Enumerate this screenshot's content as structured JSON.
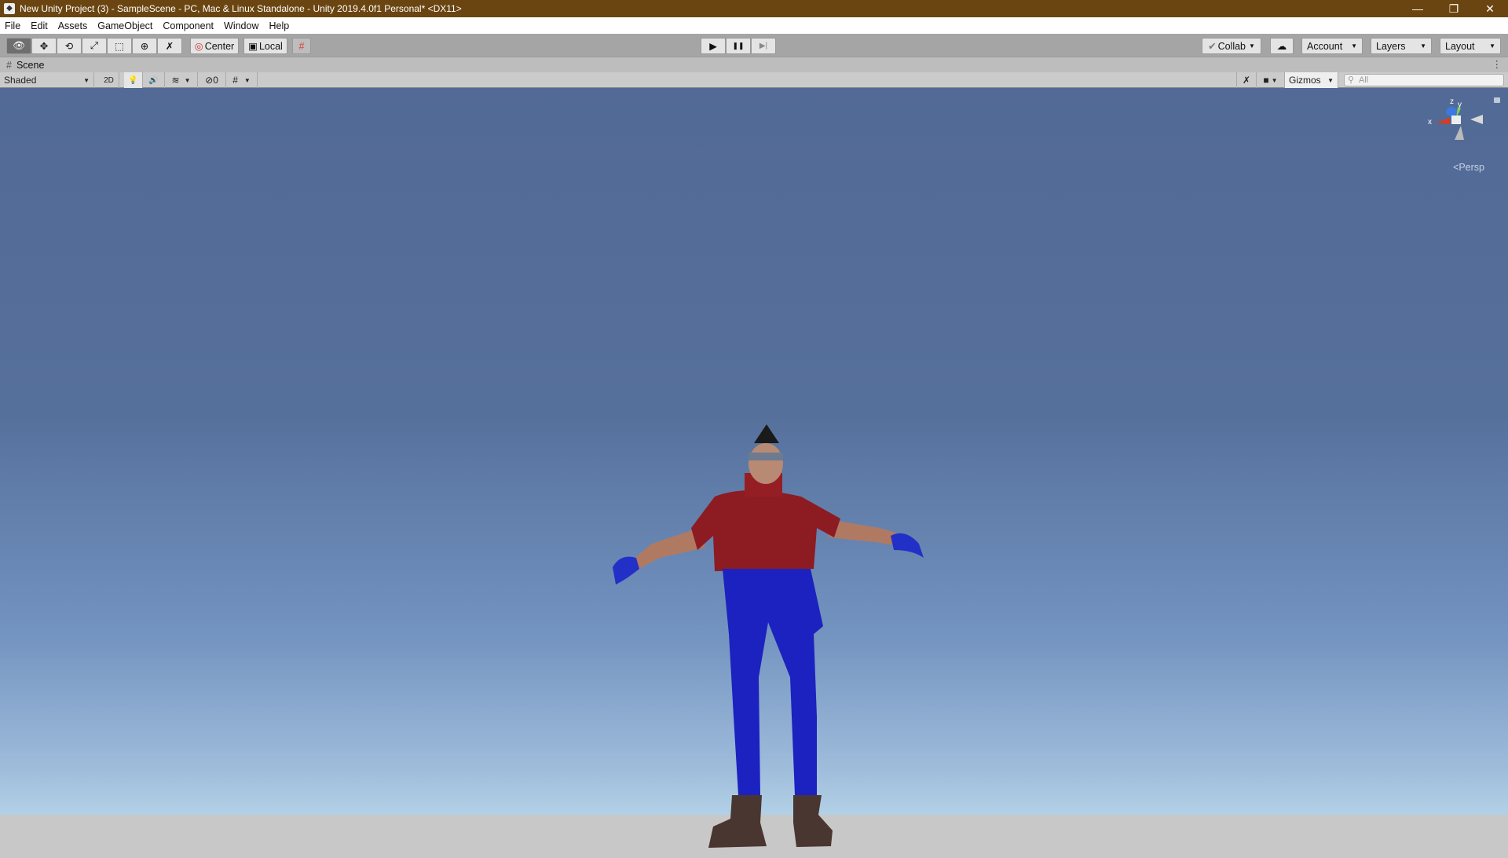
{
  "window": {
    "title": "New Unity Project (3) - SampleScene - PC, Mac & Linux Standalone - Unity 2019.4.0f1 Personal* <DX11>",
    "minimize": "—",
    "restore": "❐",
    "close": "✕"
  },
  "menu": [
    "File",
    "Edit",
    "Assets",
    "GameObject",
    "Component",
    "Window",
    "Help"
  ],
  "toolbar": {
    "tools": [
      {
        "name": "view-tool",
        "icon": "👁"
      },
      {
        "name": "move-tool",
        "icon": "✥"
      },
      {
        "name": "rotate-tool",
        "icon": "⟲"
      },
      {
        "name": "scale-tool",
        "icon": "⤢"
      },
      {
        "name": "rect-tool",
        "icon": "⬚"
      },
      {
        "name": "transform-tool",
        "icon": "⊕"
      },
      {
        "name": "custom-tool",
        "icon": "✗"
      }
    ],
    "pivot": "Center",
    "space": "Local",
    "snap_icon": "#",
    "play": "▶",
    "pause": "❚❚",
    "step": "▶|",
    "collab": "Collab",
    "cloud_icon": "☁",
    "account": "Account",
    "layers": "Layers",
    "layout": "Layout"
  },
  "scene": {
    "tab": "Scene",
    "tab_icon": "#",
    "draw_mode": "Shaded",
    "mode_2d": "2D",
    "lighting_icon": "💡",
    "audio_icon": "🔊",
    "effects_icon": "≋",
    "hidden_count": "0",
    "hidden_icon": "⊘",
    "grid_icon": "#",
    "tools_icon": "✗",
    "camera_icon": "■",
    "gizmos": "Gizmos",
    "search_placeholder": "All",
    "kebab": "⋮"
  },
  "orientation": {
    "x": "x",
    "y": "y",
    "z": "z",
    "projection": "Persp"
  }
}
